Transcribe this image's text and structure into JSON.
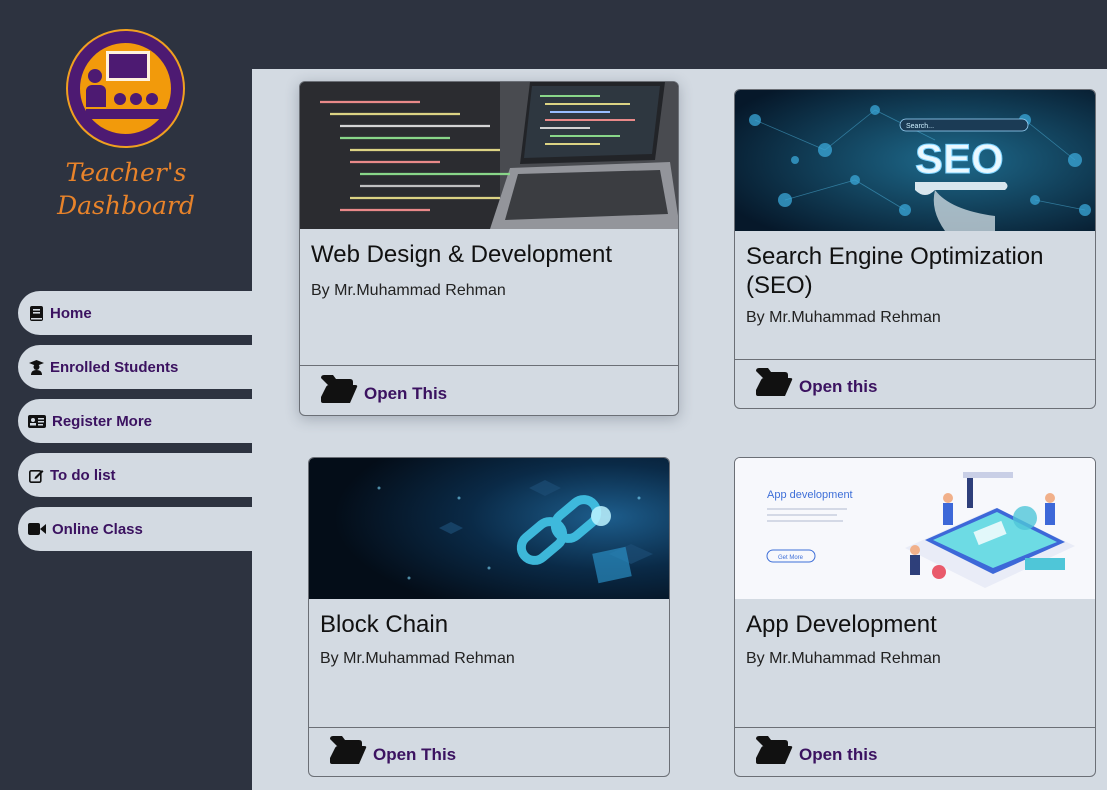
{
  "brand": {
    "line1": "Teacher's",
    "line2": "Dashboard"
  },
  "nav": [
    {
      "label": "Home",
      "icon": "book-icon"
    },
    {
      "label": "Enrolled Students",
      "icon": "graduate-icon"
    },
    {
      "label": "Register More",
      "icon": "id-card-icon"
    },
    {
      "label": "To do list",
      "icon": "edit-icon"
    },
    {
      "label": "Online Class",
      "icon": "video-icon"
    }
  ],
  "courses": [
    {
      "title": "Web Design & Development",
      "author": "By Mr.Muhammad Rehman",
      "action": "Open This",
      "image": "code-laptop-image"
    },
    {
      "title": "Search Engine Optimization (SEO)",
      "author": "By Mr.Muhammad Rehman",
      "action": "Open this",
      "image": "seo-image",
      "image_text": "SEO",
      "search_text": "Search..."
    },
    {
      "title": "Block Chain",
      "author": "By Mr.Muhammad Rehman",
      "action": "Open This",
      "image": "blockchain-image"
    },
    {
      "title": "App Development",
      "author": "By Mr.Muhammad Rehman",
      "action": "Open this",
      "image": "app-development-image",
      "image_text": "App development",
      "image_button": "Get More"
    }
  ],
  "colors": {
    "sidebar": "#2d3340",
    "panel": "#d3dae2",
    "accent": "#3b1260",
    "brand": "#e8832a"
  }
}
